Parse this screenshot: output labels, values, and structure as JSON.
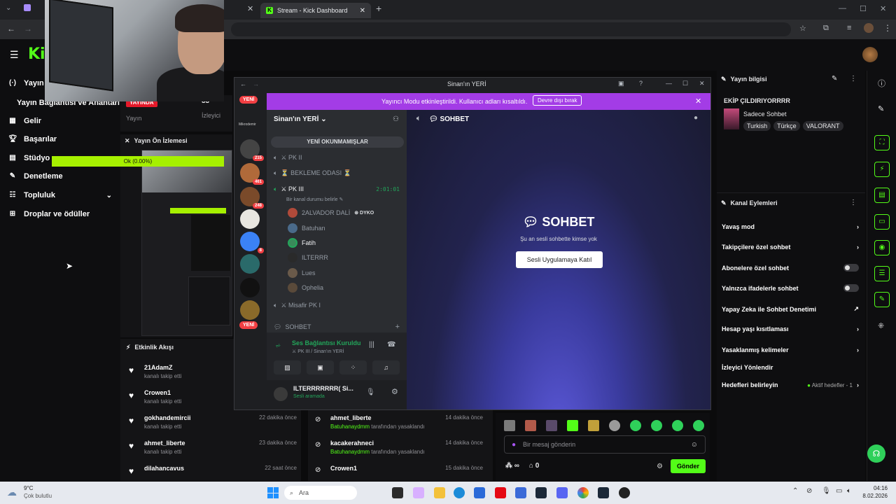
{
  "browser": {
    "tab_active_title": "Stream - Kick Dashboard",
    "new_tab_icon": "plus-icon"
  },
  "kick": {
    "logo": "Ki",
    "nav": {
      "header": "Yayın",
      "subheader": "Yayın Bağlantısı ve Anahtarı",
      "items": [
        "Gelir",
        "Başarılar",
        "Stüdyo",
        "Denetleme",
        "Topluluk",
        "Droplar ve ödüller"
      ]
    },
    "progress_overlay": "Ok (0.00%)",
    "stream_card": {
      "live_badge": "YAYINDA",
      "label": "Yayın",
      "viewers_value": "33",
      "viewers_label": "İzleyici"
    },
    "preview": {
      "title": "Yayın Ön İzlemesi"
    },
    "activity": {
      "title": "Etkinlik Akışı",
      "items": [
        {
          "name": "21AdamZ",
          "action": "kanalı takip etti",
          "time": ""
        },
        {
          "name": "Crowen1",
          "action": "kanalı takip etti",
          "time": ""
        },
        {
          "name": "gokhandemircii",
          "action": "kanalı takip etti",
          "time": "22 dakika önce"
        },
        {
          "name": "ahmet_liberte",
          "action": "kanalı takip etti",
          "time": "23 dakika önce"
        },
        {
          "name": "dilahancavus",
          "action": "",
          "time": "22 saat önce"
        }
      ]
    },
    "mod_log": [
      {
        "name": "ahmet_liberte",
        "by": "Batuhanaydmm",
        "action": "tarafından yasaklandı",
        "time": "14 dakika önce"
      },
      {
        "name": "kacakerahneci",
        "by": "Batuhanaydmm",
        "action": "tarafından yasaklandı",
        "time": "14 dakika önce"
      },
      {
        "name": "Crowen1",
        "by": "",
        "action": "",
        "time": "15 dakika önce"
      }
    ],
    "chat": {
      "placeholder": "Bir mesaj gönderin",
      "send": "Gönder",
      "infinity": "∞",
      "count": "0"
    },
    "stream_info": {
      "title": "Yayın bilgisi",
      "stream_title": "EKİP ÇILDIRIYORRRR",
      "category": "Sadece Sohbet",
      "tags": [
        "Turkish",
        "Türkçe",
        "VALORANT"
      ]
    },
    "channel_actions": {
      "title": "Kanal Eylemleri",
      "items": [
        {
          "label": "Yavaş mod",
          "control": "chevron"
        },
        {
          "label": "Takipçilere özel sohbet",
          "control": "chevron"
        },
        {
          "label": "Abonelere özel sohbet",
          "control": "toggle"
        },
        {
          "label": "Yalnızca ifadelerle sohbet",
          "control": "toggle"
        },
        {
          "label": "Yapay Zeka ile Sohbet Denetimi",
          "control": "external"
        },
        {
          "label": "Hesap yaşı kısıtlaması",
          "control": "chevron"
        },
        {
          "label": "Yasaklanmış kelimeler",
          "control": "chevron"
        },
        {
          "label": "İzleyici Yönlendir",
          "control": "none"
        },
        {
          "label": "Hedefleri belirleyin",
          "control": "chevron",
          "extra": "Aktif hedefler - 1"
        }
      ]
    }
  },
  "discord": {
    "window_title": "Sinan'ın YERİ",
    "banner_text": "Yayıncı Modu etkinleştirildi. Kullanıcı adları kısaltıldı.",
    "banner_button": "Devre dışı bırak",
    "server_name": "Sinan'ın YERİ",
    "new_label": "YENİ",
    "mikrodemir": "Mikrodemir",
    "unread_button": "YENİ OKUNMAMIŞLAR",
    "server_badges": [
      "215",
      "461",
      "248",
      "8"
    ],
    "channels": [
      "⚔ PK II",
      "⏳ BEKLEME ODASI ⏳",
      "⚔ PK III",
      "⚔ Misafir PK I"
    ],
    "pk3_timer": "2:01:01",
    "status_set": "Bir kanal durumu belirle",
    "members": [
      {
        "name": "2ALVADOR DALİ",
        "extra": "DYKO"
      },
      {
        "name": "Batuhan",
        "extra": ""
      },
      {
        "name": "Fatih",
        "extra": ""
      },
      {
        "name": "ILTERRR",
        "extra": ""
      },
      {
        "name": "Lues",
        "extra": ""
      },
      {
        "name": "Ophelia",
        "extra": ""
      }
    ],
    "text_channel": "SOHBET",
    "voice_status": "Ses Bağlantısı Kuruldu",
    "voice_sub": "⚔ PK III / Sinan'ın YERİ",
    "user_name": "ILTERRRRRRR( Si...",
    "user_status": "Sesli aramada",
    "main_header": "SOHBET",
    "main_title": "SOHBET",
    "main_sub": "Şu an sesli sohbette kimse yok",
    "main_button": "Sesli Uygulamaya Katıl"
  },
  "taskbar": {
    "weather_temp": "9°C",
    "weather_desc": "Çok bulutlu",
    "search": "Ara",
    "time": "04:16",
    "date": "8.02.2026"
  }
}
